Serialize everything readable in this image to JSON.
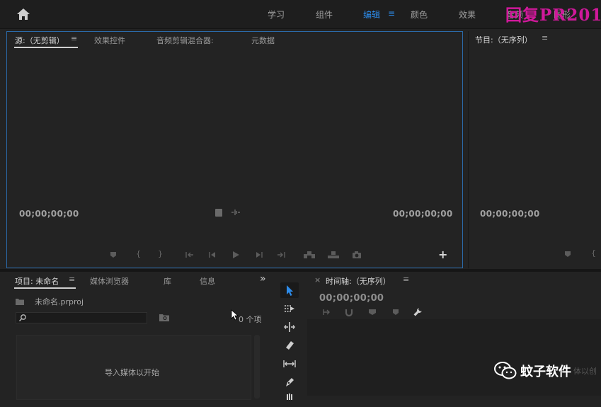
{
  "header": {
    "home_icon": "home-icon",
    "workspaces": [
      "学习",
      "组件",
      "编辑",
      "颜色",
      "效果",
      "音频",
      "图形"
    ],
    "active_workspace": "编辑",
    "menu_glyph": "≡"
  },
  "watermark": "回复PR201",
  "source_panel": {
    "tabs": [
      "源:（无剪辑）",
      "效果控件",
      "音频剪辑混合器:",
      "元数据"
    ],
    "menu_glyph": "≡",
    "timecode_left": "00;00;00;00",
    "timecode_right": "00;00;00;00",
    "add_glyph": "+"
  },
  "program_panel": {
    "title": "节目:（无序列）",
    "menu_glyph": "≡",
    "timecode": "00;00;00;00"
  },
  "project_panel": {
    "tabs": [
      "项目: 未命名",
      "媒体浏览器",
      "库",
      "信息"
    ],
    "menu_glyph": "≡",
    "overflow": "»",
    "filename": "未命名.prproj",
    "search_value": "",
    "item_count": "0 个项",
    "import_hint": "导入媒体以开始"
  },
  "timeline_panel": {
    "close_glyph": "×",
    "title": "时间轴:（无序列）",
    "menu_glyph": "≡",
    "timecode": "00;00;00;00",
    "hint_fragment": "体以创"
  },
  "wechat_badge": {
    "icon": "wechat-icon",
    "label": "蚊子软件"
  },
  "colors": {
    "accent": "#2d8ceb",
    "panel_bg": "#232323",
    "focus_border": "#2b6aa9",
    "watermark": "#d0199b"
  }
}
